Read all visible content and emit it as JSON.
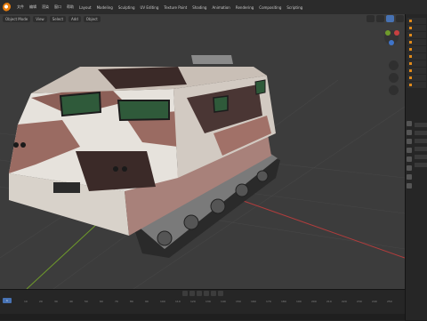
{
  "menubar": {
    "items": [
      "文件",
      "编辑",
      "渲染",
      "窗口",
      "帮助",
      "Layout",
      "Modeling",
      "Sculpting",
      "UV Editing",
      "Texture Paint",
      "Shading",
      "Animation",
      "Rendering",
      "Compositing",
      "Scripting"
    ]
  },
  "viewport_header": {
    "mode": "Object Mode",
    "view": "View",
    "select": "Select",
    "add": "Add",
    "object": "Object"
  },
  "timeline": {
    "current_frame": "1",
    "ticks": [
      "0",
      "10",
      "20",
      "30",
      "40",
      "50",
      "60",
      "70",
      "80",
      "90",
      "100",
      "110",
      "120",
      "130",
      "140",
      "150",
      "160",
      "170",
      "180",
      "190",
      "200",
      "210",
      "220",
      "230",
      "240",
      "250"
    ]
  },
  "colors": {
    "accent": "#4772b3",
    "viewport_bg": "#3c3c3c",
    "x_axis": "#b33c3c",
    "y_axis": "#6f9b2b",
    "camo_light": "#e6e2dc",
    "camo_mid": "#9a6b62",
    "camo_dark": "#3b2a28"
  },
  "icons": [
    "blender-logo-icon",
    "object-mode-icon",
    "viewport-shading-icon",
    "navigation-gizmo-icon",
    "zoom-icon",
    "pan-icon",
    "camera-icon",
    "play-icon"
  ]
}
